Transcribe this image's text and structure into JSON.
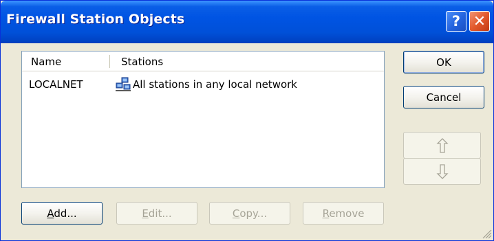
{
  "window": {
    "title": "Firewall Station Objects",
    "help_label": "?",
    "close_label": "✕"
  },
  "list": {
    "columns": [
      "Name",
      "Stations"
    ],
    "rows": [
      {
        "name": "LOCALNET",
        "stations": "All stations in any local network",
        "icon": "network-icon"
      }
    ]
  },
  "buttons": {
    "ok": "OK",
    "cancel": "Cancel",
    "add_rest": "dd...",
    "edit_rest": "dit...",
    "copy_rest": "opy...",
    "remove_rest": "emove"
  },
  "mnemonics": {
    "add": "A",
    "edit": "E",
    "copy": "C",
    "remove": "R"
  },
  "states": {
    "edit_enabled": false,
    "copy_enabled": false,
    "remove_enabled": false,
    "move_up_enabled": false,
    "move_down_enabled": false
  },
  "icons": [
    "help-icon",
    "close-icon",
    "network-icon",
    "arrow-up-icon",
    "arrow-down-icon",
    "size-grip-icon"
  ]
}
